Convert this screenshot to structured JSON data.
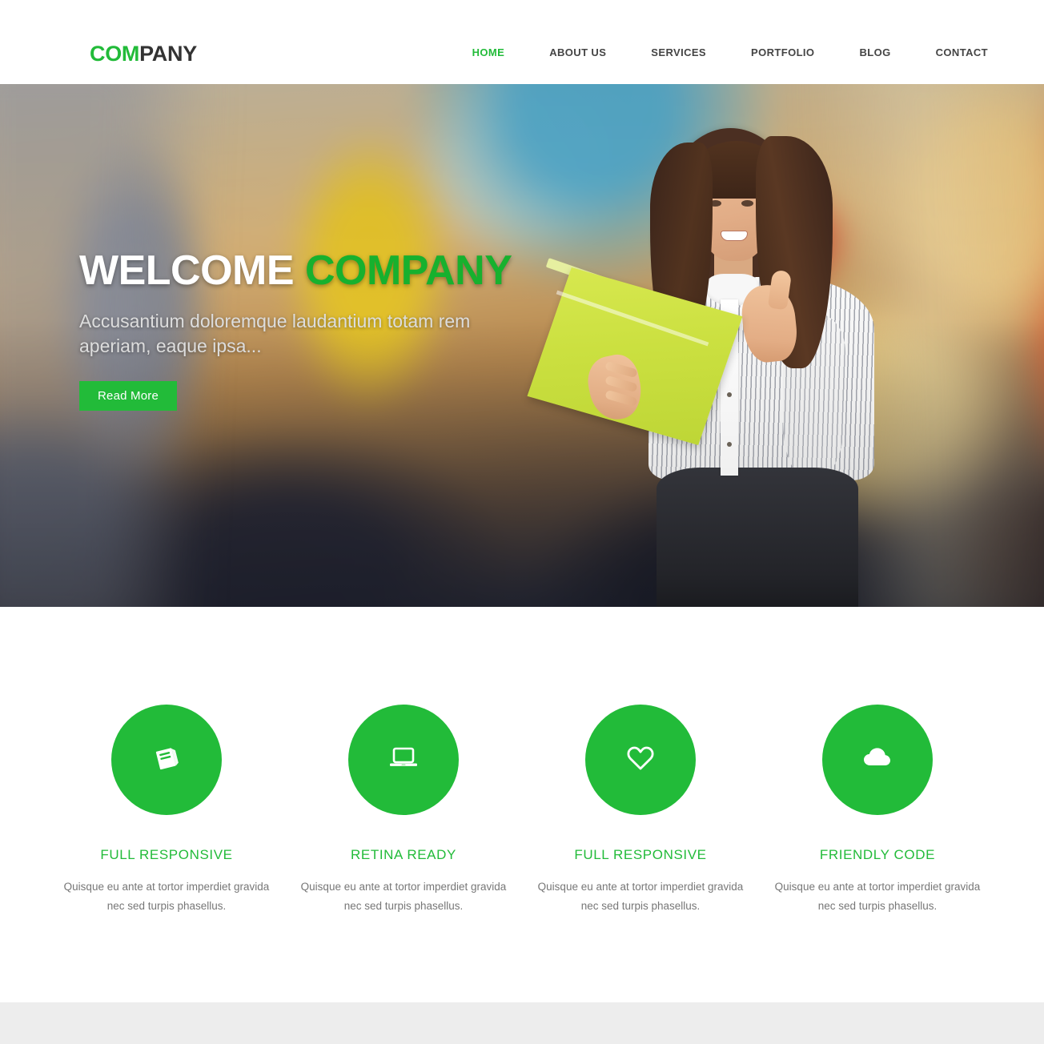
{
  "header": {
    "logo": {
      "accent_text": "COM",
      "rest_text": "PANY",
      "accent_color": "#22bb39",
      "rest_color": "#333333"
    },
    "nav": [
      {
        "label": "HOME",
        "active": true
      },
      {
        "label": "ABOUT US",
        "active": false
      },
      {
        "label": "SERVICES",
        "active": false
      },
      {
        "label": "PORTFOLIO",
        "active": false
      },
      {
        "label": "BLOG",
        "active": false
      },
      {
        "label": "CONTACT",
        "active": false
      }
    ]
  },
  "hero": {
    "title_white": "WELCOME ",
    "title_accent": "COMPANY",
    "subtitle": "Accusantium doloremque laudantium totam rem aperiam, eaque ipsa...",
    "button_label": "Read More",
    "accent_color": "#17b12e",
    "button_color": "#22bb39",
    "image_alt": "businesswoman-holding-green-folder-thumbs-up-on-blurred-city-street"
  },
  "features": [
    {
      "icon": "book-icon",
      "title": "FULL RESPONSIVE",
      "description": "Quisque eu ante at tortor imperdiet gravida nec sed turpis phasellus."
    },
    {
      "icon": "laptop-icon",
      "title": "RETINA READY",
      "description": "Quisque eu ante at tortor imperdiet gravida nec sed turpis phasellus."
    },
    {
      "icon": "heart-icon",
      "title": "FULL RESPONSIVE",
      "description": "Quisque eu ante at tortor imperdiet gravida nec sed turpis phasellus."
    },
    {
      "icon": "cloud-icon",
      "title": "FRIENDLY CODE",
      "description": "Quisque eu ante at tortor imperdiet gravida nec sed turpis phasellus."
    }
  ],
  "theme": {
    "green": "#22bb39",
    "dark_text": "#333333",
    "body_text": "#777777",
    "band_gray": "#ededed"
  }
}
